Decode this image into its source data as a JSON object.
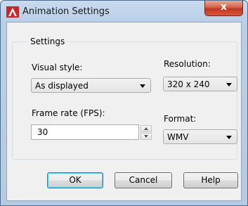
{
  "window": {
    "title": "Animation Settings",
    "close_glyph": "x",
    "icon": "autocad-a-icon",
    "accent": "#c0361f"
  },
  "settings": {
    "group_label": "Settings",
    "visual_style": {
      "label": "Visual style:",
      "value": "As displayed"
    },
    "resolution": {
      "label": "Resolution:",
      "value": "320 x 240"
    },
    "frame_rate": {
      "label": "Frame rate (FPS):",
      "value": "30"
    },
    "format": {
      "label": "Format:",
      "value": "WMV"
    }
  },
  "buttons": {
    "ok": "OK",
    "cancel": "Cancel",
    "help": "Help"
  }
}
